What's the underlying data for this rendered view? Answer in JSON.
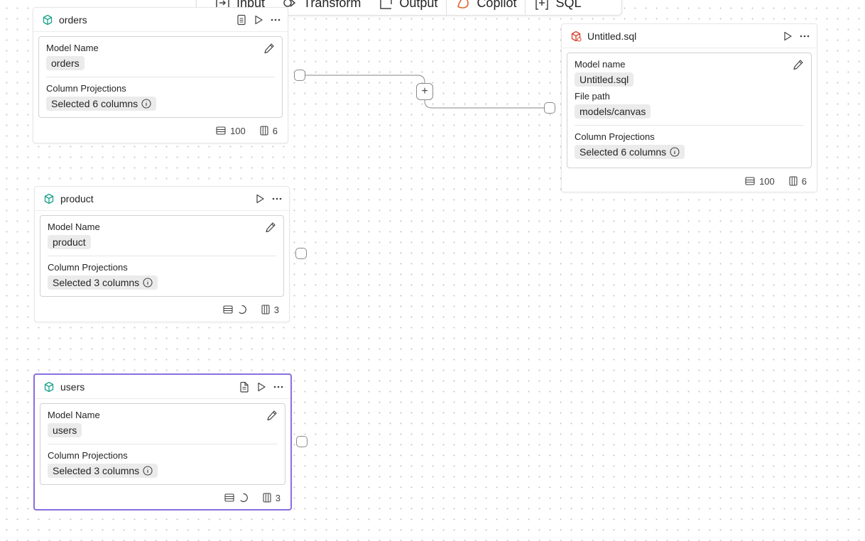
{
  "toolbar": {
    "items": [
      {
        "label": "Input",
        "icon": "input-icon"
      },
      {
        "label": "Transform",
        "icon": "transform-icon"
      },
      {
        "label": "Output",
        "icon": "output-icon"
      },
      {
        "label": "Copilot",
        "icon": "copilot-icon"
      },
      {
        "label": "SQL",
        "icon": "sql-icon"
      }
    ]
  },
  "nodes": {
    "orders": {
      "title": "orders",
      "field1_label": "Model Name",
      "field1_value": "orders",
      "field2_label": "Column Projections",
      "field2_value": "Selected 6 columns",
      "rows": "100",
      "columns": "6"
    },
    "product": {
      "title": "product",
      "field1_label": "Model Name",
      "field1_value": "product",
      "field2_label": "Column Projections",
      "field2_value": "Selected 3 columns",
      "columns": "3"
    },
    "users": {
      "title": "users",
      "field1_label": "Model Name",
      "field1_value": "users",
      "field2_label": "Column Projections",
      "field2_value": "Selected 3 columns",
      "columns": "3"
    },
    "untitled": {
      "title": "Untitled.sql",
      "field1_label": "Model name",
      "field1_value": "Untitled.sql",
      "path_label": "File path",
      "path_value": "models/canvas",
      "field2_label": "Column Projections",
      "field2_value": "Selected 6 columns",
      "rows": "100",
      "columns": "6"
    }
  },
  "colors": {
    "model_icon": "#1aa38a",
    "sql_icon": "#d9412b",
    "selected_border": "#8b6fe0"
  },
  "connector": {
    "add_label": "+"
  }
}
